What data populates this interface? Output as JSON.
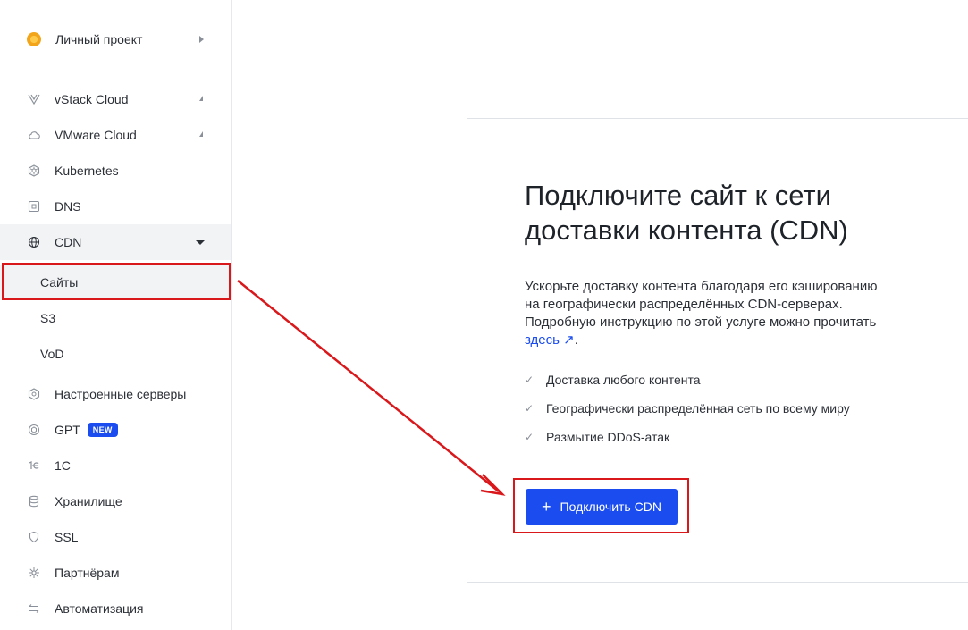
{
  "project": {
    "name": "Личный проект"
  },
  "nav": [
    {
      "label": "vStack Cloud",
      "icon": "vstack-icon"
    },
    {
      "label": "VMware Cloud",
      "icon": "cloud-icon"
    },
    {
      "label": "Kubernetes",
      "icon": "kubernetes-icon"
    },
    {
      "label": "DNS",
      "icon": "dns-icon"
    },
    {
      "label": "CDN",
      "icon": "globe-icon"
    }
  ],
  "cdn_sub": [
    "Сайты",
    "S3",
    "VoD"
  ],
  "nav2": [
    {
      "label": "Настроенные серверы",
      "icon": "configured-servers-icon"
    },
    {
      "label": "GPT",
      "icon": "gpt-icon",
      "badge": "NEW"
    },
    {
      "label": "1C",
      "icon": "1c-icon"
    },
    {
      "label": "Хранилище",
      "icon": "storage-icon"
    },
    {
      "label": "SSL",
      "icon": "shield-icon"
    },
    {
      "label": "Партнёрам",
      "icon": "partners-icon"
    },
    {
      "label": "Автоматизация",
      "icon": "automation-icon"
    }
  ],
  "main": {
    "title_line1": "Подключите сайт к сети",
    "title_line2": "доставки контента (CDN)",
    "desc_line1": "Ускорьте доставку контента благодаря его кэшированию",
    "desc_line2": "на географически распределённых CDN-серверах.",
    "desc_line3": "Подробную инструкцию по этой услуге можно прочитать",
    "desc_link": "здесь ↗",
    "desc_end": ".",
    "features": [
      "Доставка любого контента",
      "Географически распределённая сеть по всему миру",
      "Размытие DDoS-атак"
    ],
    "cta_label": "Подключить CDN"
  },
  "colors": {
    "accent": "#1a4cf0",
    "highlight": "#d9181c"
  }
}
